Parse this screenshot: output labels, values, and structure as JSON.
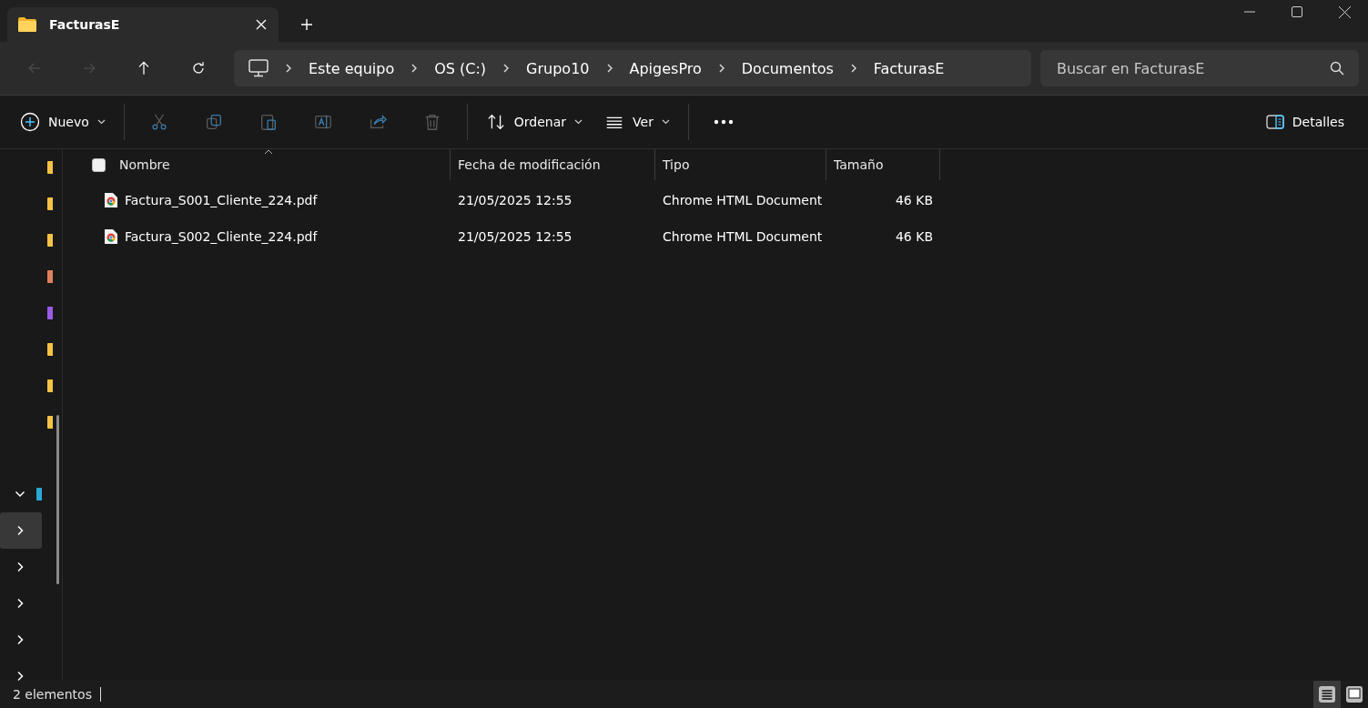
{
  "window": {
    "tab": {
      "title": "FacturasE"
    }
  },
  "navigation": [
    {
      "kind": "back",
      "disabled": true
    },
    {
      "kind": "forward",
      "disabled": true
    },
    {
      "kind": "up",
      "disabled": false
    },
    {
      "kind": "refresh",
      "disabled": false
    }
  ],
  "breadcrumb": [
    "Este equipo",
    "OS (C:)",
    "Grupo10",
    "ApigesPro",
    "Documentos",
    "FacturasE"
  ],
  "search": {
    "placeholder": "Buscar en FacturasE"
  },
  "toolbar": {
    "new": {
      "label": "Nuevo"
    },
    "actions": [
      {
        "kind": "cut",
        "disabled": true
      },
      {
        "kind": "copy",
        "disabled": true
      },
      {
        "kind": "paste",
        "disabled": true
      },
      {
        "kind": "rename",
        "disabled": true
      },
      {
        "kind": "share",
        "disabled": true
      },
      {
        "kind": "delete",
        "disabled": true
      }
    ],
    "menus": [
      {
        "kind": "sort",
        "label": "Ordenar"
      },
      {
        "kind": "view",
        "label": "Ver"
      }
    ],
    "details": {
      "label": "Detalles"
    }
  },
  "sidebar": {
    "pinned": [
      {
        "color": "#f5c242"
      },
      {
        "color": "#f5c242"
      },
      {
        "color": "#f5c242"
      },
      {
        "color": "#e0805f"
      },
      {
        "color": "#9a5ce6"
      },
      {
        "color": "#f5c242"
      },
      {
        "color": "#f5c242"
      },
      {
        "color": "#f5c242"
      }
    ],
    "tree": [
      {
        "expanded": true,
        "selected": false,
        "color": "#29a9d4"
      },
      {
        "expanded": false,
        "selected": true
      },
      {
        "expanded": false,
        "selected": false
      },
      {
        "expanded": false,
        "selected": false
      },
      {
        "expanded": false,
        "selected": false
      },
      {
        "expanded": false,
        "selected": false
      }
    ]
  },
  "table": {
    "select_all": {
      "checked": false
    },
    "columns": [
      {
        "label": "Nombre",
        "sorted": true
      },
      {
        "label": "Fecha de modificación",
        "sorted": false
      },
      {
        "label": "Tipo",
        "sorted": false
      },
      {
        "label": "Tamaño",
        "sorted": false
      }
    ],
    "rows": [
      {
        "name": "Factura_S001_Cliente_224.pdf",
        "modified": "21/05/2025 12:55",
        "type": "Chrome HTML Document",
        "size": "46 KB"
      },
      {
        "name": "Factura_S002_Cliente_224.pdf",
        "modified": "21/05/2025 12:55",
        "type": "Chrome HTML Document",
        "size": "46 KB"
      }
    ]
  },
  "status_bar": {
    "count": "2 elementos",
    "views": [
      {
        "kind": "details",
        "selected": true
      },
      {
        "kind": "tiles",
        "selected": false
      }
    ]
  }
}
